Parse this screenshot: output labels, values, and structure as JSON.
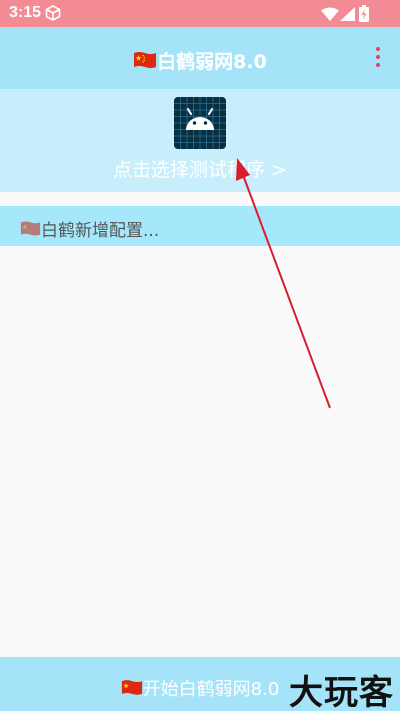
{
  "status_bar": {
    "time": "3:15",
    "icons": [
      "cube-icon",
      "wifi-icon",
      "signal-icon",
      "battery-icon"
    ]
  },
  "app_bar": {
    "title": "白鹤弱网8.0",
    "title_icon": "china-flag-icon",
    "menu_icon": "more-vert-icon"
  },
  "picker": {
    "app_icon": "android-icon",
    "hint": "点击选择测试程序 >"
  },
  "config_bar": {
    "label": "白鹤新增配置...",
    "icon": "china-flag-icon"
  },
  "bottom_bar": {
    "label": "开始白鹤弱网8.0",
    "icon": "china-flag-icon"
  },
  "watermark": {
    "text": "大玩客"
  },
  "colors": {
    "status_bar": "#f28b93",
    "app_bar": "#a5e3f9",
    "picker_bg": "#c8eefb",
    "config_bar": "#a5e8fb",
    "menu_dots": "#e0456a",
    "annotation_arrow": "#d81e2e"
  }
}
